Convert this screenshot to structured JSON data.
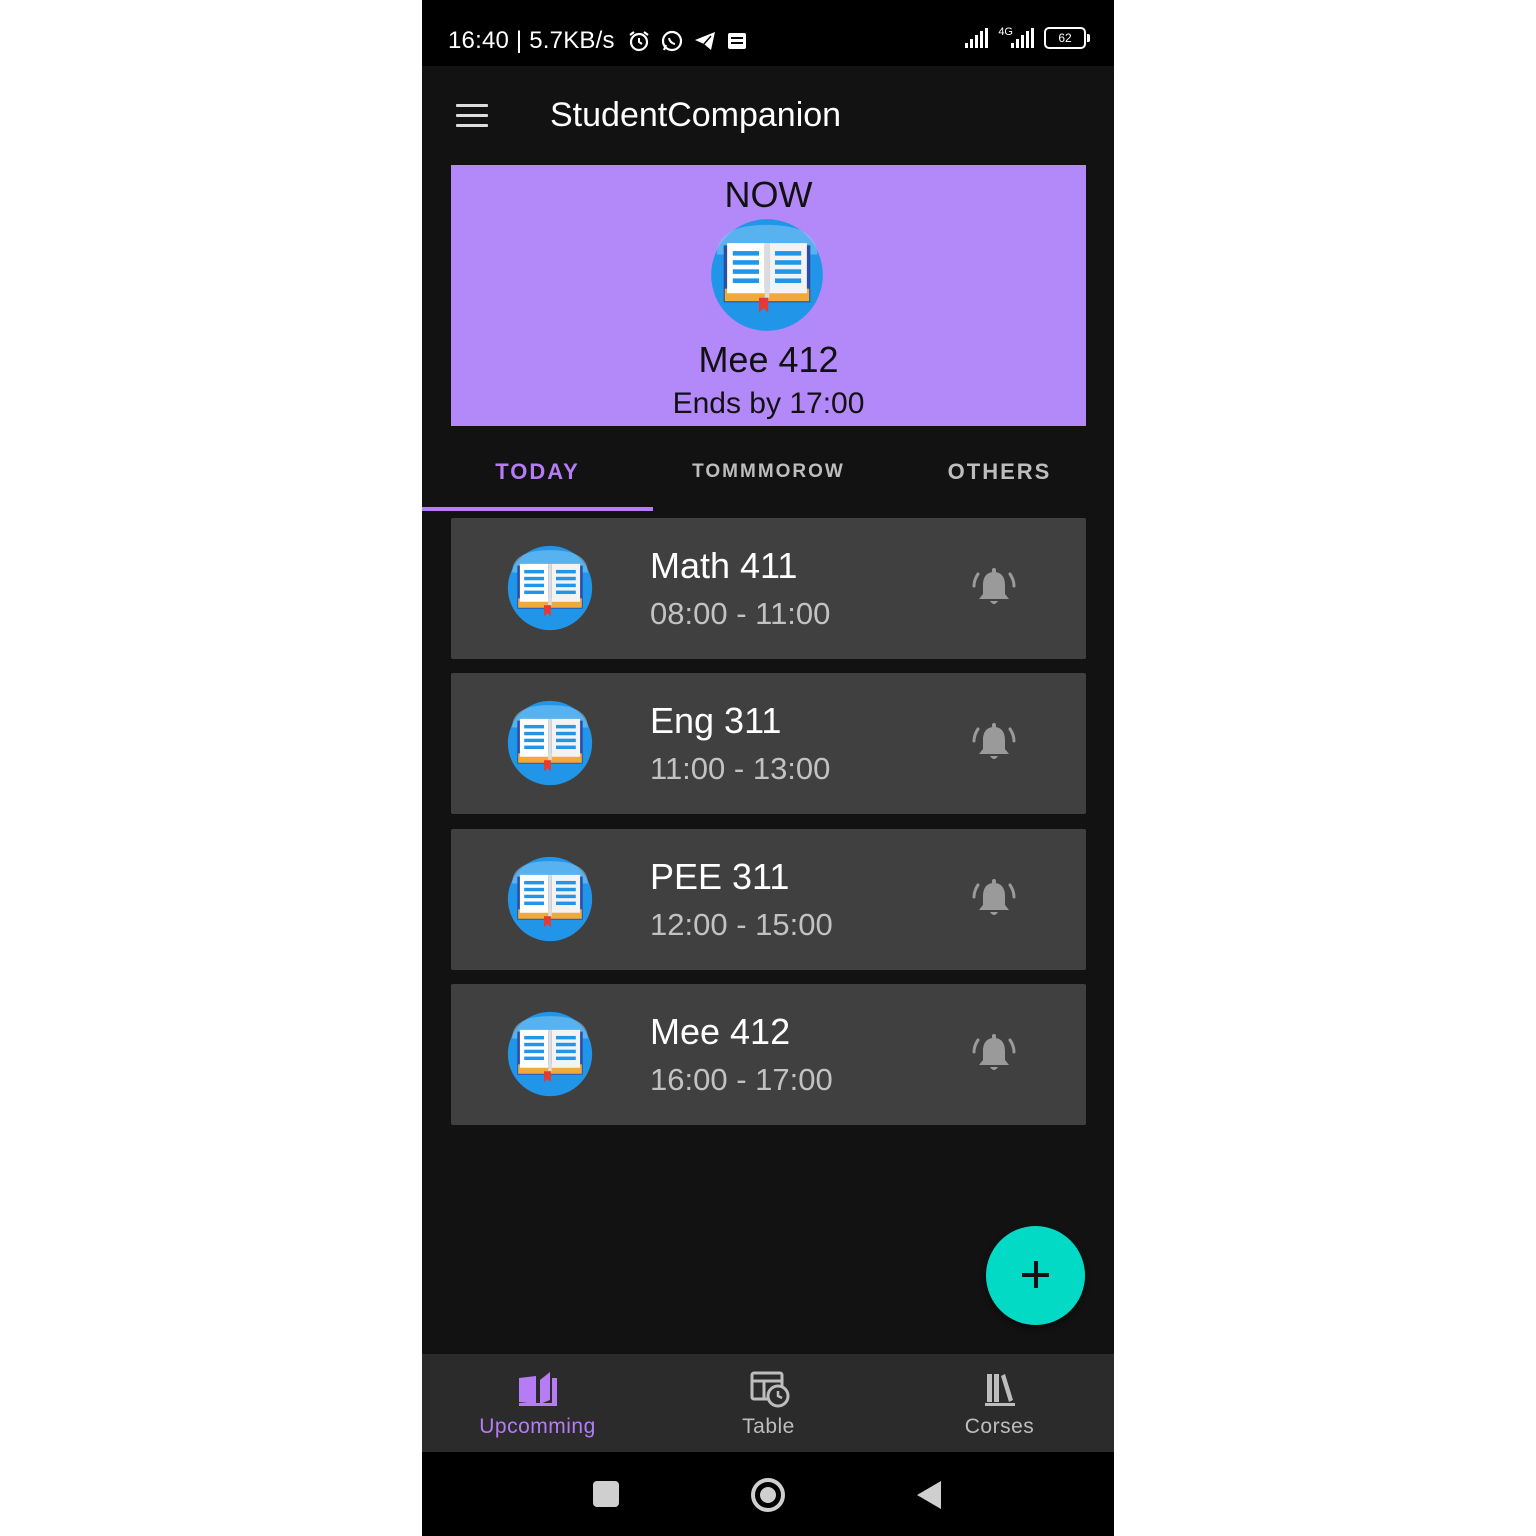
{
  "status_bar": {
    "time_speed": "16:40 | 5.7KB/s",
    "network_label": "4G",
    "battery": "62"
  },
  "app_bar": {
    "title": "StudentCompanion"
  },
  "now_card": {
    "label": "NOW",
    "course": "Mee 412",
    "ends": "Ends by 17:00",
    "color": "#b388f8"
  },
  "tabs": [
    {
      "label": "TODAY",
      "active": true
    },
    {
      "label": "TOMMMOROW",
      "active": false
    },
    {
      "label": "OTHERS",
      "active": false
    }
  ],
  "classes": [
    {
      "course": "Math 411",
      "time": "08:00 - 11:00"
    },
    {
      "course": "Eng 311",
      "time": "11:00 - 13:00"
    },
    {
      "course": "PEE 311",
      "time": "12:00 - 15:00"
    },
    {
      "course": "Mee 412",
      "time": "16:00 - 17:00"
    }
  ],
  "fab": {
    "icon": "plus-icon",
    "color": "#03dac5"
  },
  "bottom_nav": [
    {
      "label": "Upcomming",
      "icon": "open-book-icon",
      "active": true
    },
    {
      "label": "Table",
      "icon": "table-clock-icon",
      "active": false
    },
    {
      "label": "Corses",
      "icon": "library-icon",
      "active": false
    }
  ],
  "colors": {
    "accent": "#b57cf5",
    "background": "#121212",
    "card": "#404040"
  }
}
